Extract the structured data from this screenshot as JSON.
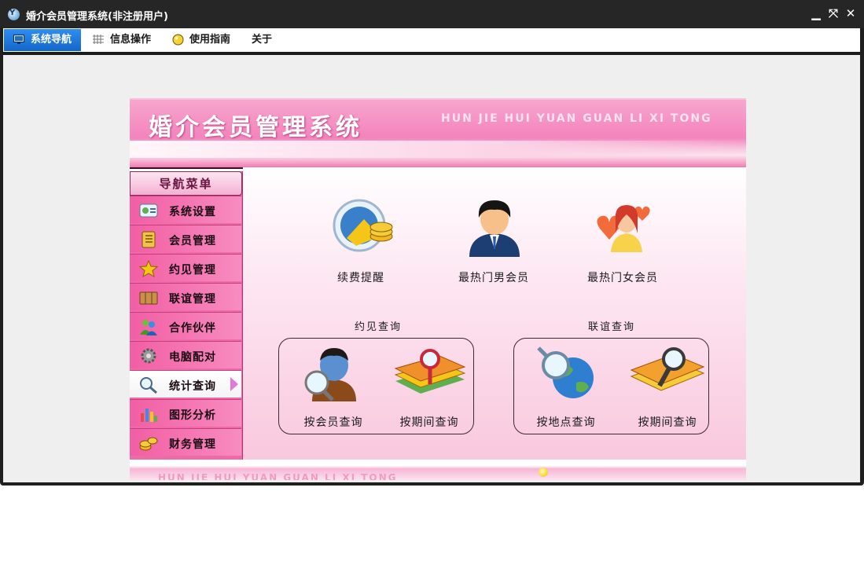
{
  "window": {
    "title": "婚介会员管理系统(非注册用户)",
    "icon_letter": "Y"
  },
  "window_buttons": {
    "minimize": "▁",
    "restore": "⤧",
    "close": "✕"
  },
  "tabs": [
    {
      "label": "系统导航",
      "icon": "monitor-icon",
      "active": true
    },
    {
      "label": "信息操作",
      "icon": "grid-icon",
      "active": false
    },
    {
      "label": "使用指南",
      "icon": "bulb-icon",
      "active": false
    },
    {
      "label": "关于",
      "icon": "",
      "active": false
    }
  ],
  "banner": {
    "title": "婚介会员管理系统",
    "pinyin": "HUN JIE HUI YUAN GUAN LI XI TONG"
  },
  "sidebar": {
    "header": "导航菜单",
    "items": [
      {
        "label": "系统设置",
        "icon": "id-card-icon"
      },
      {
        "label": "会员管理",
        "icon": "ledger-icon"
      },
      {
        "label": "约见管理",
        "icon": "star-icon"
      },
      {
        "label": "联谊管理",
        "icon": "box-icon"
      },
      {
        "label": "合作伙伴",
        "icon": "people-icon"
      },
      {
        "label": "电脑配对",
        "icon": "gear-icon"
      },
      {
        "label": "统计查询",
        "icon": "magnifier-icon",
        "selected": true
      },
      {
        "label": "图形分析",
        "icon": "bar-chart-icon"
      },
      {
        "label": "财务管理",
        "icon": "coins-icon"
      }
    ]
  },
  "main": {
    "top_tiles": [
      {
        "label": "续费提醒",
        "icon": "clock-coins-icon"
      },
      {
        "label": "最热门男会员",
        "icon": "man-avatar-icon"
      },
      {
        "label": "最热门女会员",
        "icon": "woman-hearts-icon"
      }
    ],
    "meeting_query": {
      "caption": "约见查询",
      "items": [
        {
          "label": "按会员查询",
          "icon": "person-search-icon"
        },
        {
          "label": "按期间查询",
          "icon": "books-search-icon"
        }
      ]
    },
    "party_query": {
      "caption": "联谊查询",
      "items": [
        {
          "label": "按地点查询",
          "icon": "globe-search-icon"
        },
        {
          "label": "按期间查询",
          "icon": "folder-search-icon"
        }
      ]
    }
  },
  "footer": {
    "pinyin": "HUN JIE HUI YUAN GUAN LI XI TONG"
  },
  "colors": {
    "accent_pink": "#f06aa8",
    "tab_active_blue": "#1e7ee2",
    "title_bar": "#262626"
  }
}
